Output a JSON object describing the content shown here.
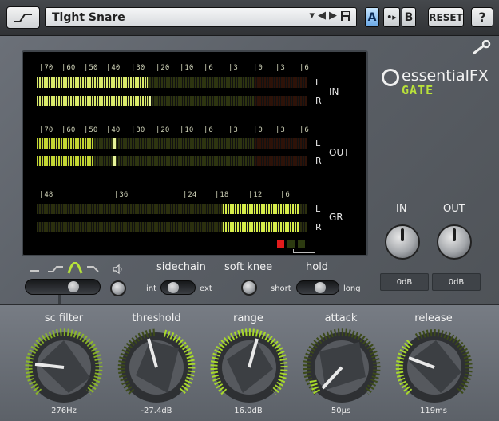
{
  "header": {
    "preset": "Tight Snare",
    "a_label": "A",
    "copy_label": "•▸",
    "b_label": "B",
    "reset_label": "RESET",
    "help_label": "?"
  },
  "logo": {
    "brand": "essentialFX",
    "product": "GATE"
  },
  "meters": {
    "in_ticks": [
      "70",
      "60",
      "50",
      "40",
      "30",
      "20",
      "10",
      "6",
      "3",
      "0",
      "3",
      "6"
    ],
    "out_ticks": [
      "70",
      "60",
      "50",
      "40",
      "30",
      "20",
      "10",
      "6",
      "3",
      "0",
      "3",
      "6"
    ],
    "gr_ticks": [
      "48",
      "36",
      "24",
      "18",
      "12",
      "6"
    ],
    "in_label": "IN",
    "out_label": "OUT",
    "gr_label": "GR",
    "left_label": "L",
    "right_label": "R",
    "in_level": 0.41,
    "out_level": 0.21,
    "gr_level": 0.28,
    "colors": {
      "level": "#d9e96a",
      "gr": "#d6ec4a",
      "clip": "#e11c1c"
    }
  },
  "io": {
    "in_label": "IN",
    "out_label": "OUT",
    "in_value": "0dB",
    "out_value": "0dB"
  },
  "sidechain": {
    "label": "sidechain",
    "left": "int",
    "right": "ext"
  },
  "soft_knee": {
    "label": "soft knee"
  },
  "hold": {
    "label": "hold",
    "left": "short",
    "right": "long"
  },
  "knobs": [
    {
      "label": "sc filter",
      "value": "276Hz"
    },
    {
      "label": "threshold",
      "value": "-27.4dB"
    },
    {
      "label": "range",
      "value": "16.0dB"
    },
    {
      "label": "attack",
      "value": "50µs"
    },
    {
      "label": "release",
      "value": "119ms"
    }
  ],
  "accent_color": "#9fd12b"
}
